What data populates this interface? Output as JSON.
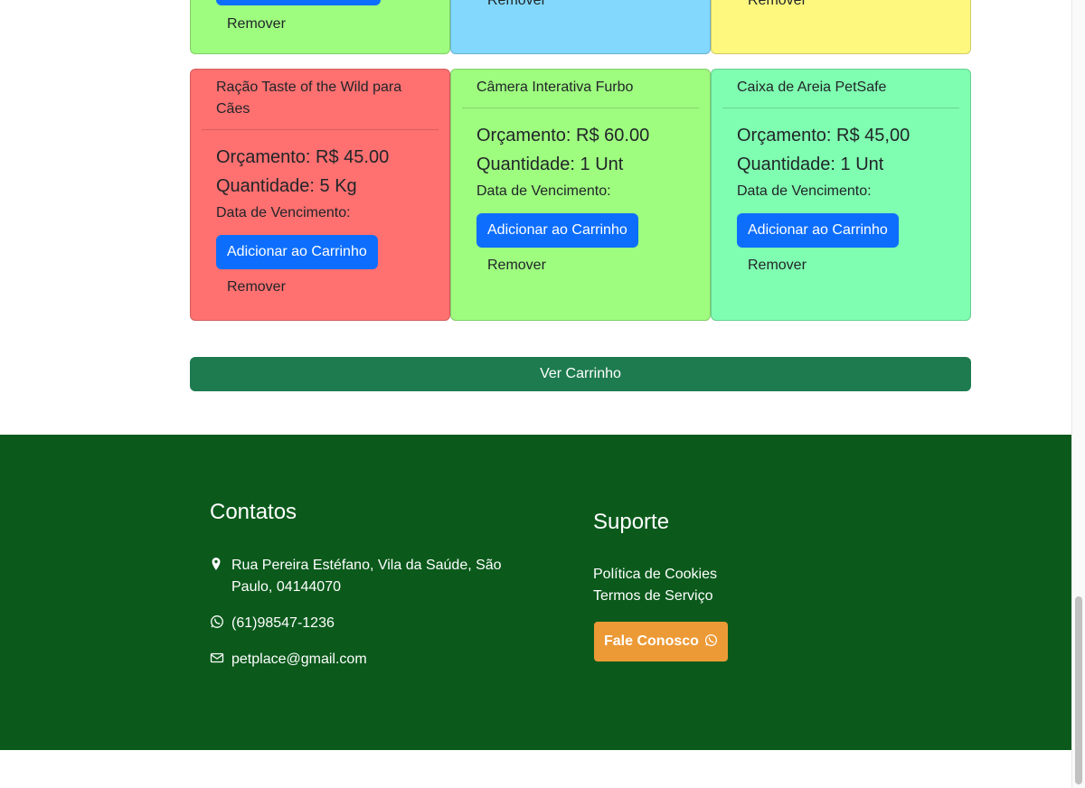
{
  "top_row": [
    {
      "color": "#9efc7f",
      "remove_label": "Remover"
    },
    {
      "color": "#82d8fd",
      "remove_label": "Remover"
    },
    {
      "color": "#fff87e",
      "remove_label": "Remover"
    }
  ],
  "products": [
    {
      "name": "Ração Taste of the Wild para Cães",
      "budget": "Orçamento: R$ 45.00",
      "quantity": "Quantidade: 5 Kg",
      "due_label": "Data de Vencimento:",
      "add_label": "Adicionar ao Carrinho",
      "remove_label": "Remover",
      "color": "#ff7070"
    },
    {
      "name": "Câmera Interativa Furbo",
      "budget": "Orçamento: R$ 60.00",
      "quantity": "Quantidade: 1 Unt",
      "due_label": "Data de Vencimento:",
      "add_label": "Adicionar ao Carrinho",
      "remove_label": "Remover",
      "color": "#9efc7f"
    },
    {
      "name": "Caixa de Areia PetSafe",
      "budget": "Orçamento: R$ 45,00",
      "quantity": "Quantidade: 1 Unt",
      "due_label": "Data de Vencimento:",
      "add_label": "Adicionar ao Carrinho",
      "remove_label": "Remover",
      "color": "#7ffdb0"
    }
  ],
  "view_cart_label": "Ver Carrinho",
  "footer": {
    "contacts_title": "Contatos",
    "address_line1": "Rua Pereira Estéfano, Vila da Saúde, São",
    "address_line2": "Paulo, 04144070",
    "phone": "(61)98547-1236",
    "email": "petplace@gmail.com",
    "support_title": "Suporte",
    "cookies_link": "Política de Cookies",
    "terms_link": "Termos de Serviço",
    "contact_button": "Fale Conosco",
    "background": "#0b5a1c",
    "button_color": "#ec9a36"
  },
  "icons": {
    "address": "map-pin-icon",
    "phone": "whatsapp-icon",
    "email": "envelope-icon"
  }
}
